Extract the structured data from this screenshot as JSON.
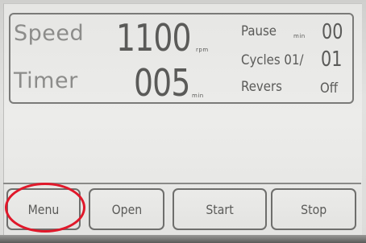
{
  "status": {
    "speed_label": "Speed",
    "speed_value": "1100",
    "speed_unit": "rpm",
    "timer_label": "Timer",
    "timer_value": "005",
    "timer_unit": "min",
    "pause_label": "Pause",
    "pause_unit": "min",
    "pause_value": "00",
    "cycles_label": "Cycles 01/",
    "cycles_value": "01",
    "revers_label": "Revers",
    "revers_value": "Off"
  },
  "buttons": {
    "menu": "Menu",
    "open": "Open",
    "start": "Start",
    "stop": "Stop"
  },
  "colors": {
    "highlight": "#e0182a"
  }
}
